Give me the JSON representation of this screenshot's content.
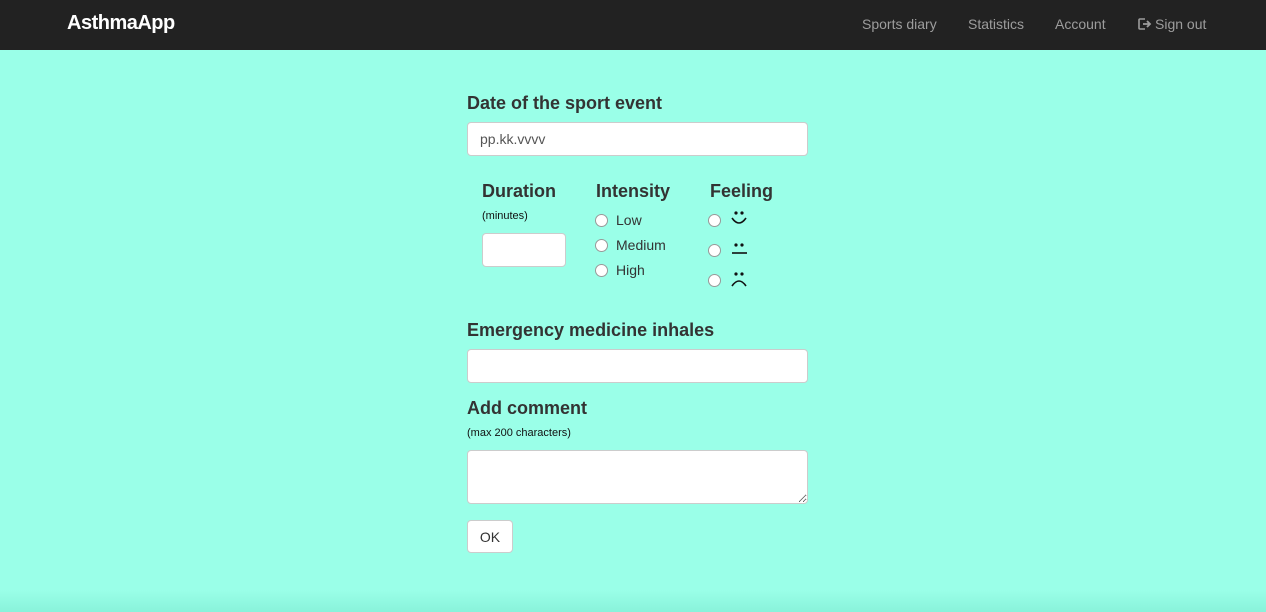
{
  "navbar": {
    "brand": "AsthmaApp",
    "links": {
      "sports_diary": "Sports diary",
      "statistics": "Statistics",
      "account": "Account",
      "sign_out": "Sign out"
    },
    "sign_out_icon": "sign-out-icon"
  },
  "form": {
    "date": {
      "label": "Date of the sport event",
      "placeholder": "pp.kk.vvvv",
      "value": ""
    },
    "duration": {
      "label": "Duration",
      "hint": "(minutes)",
      "value": ""
    },
    "intensity": {
      "label": "Intensity",
      "options": [
        "Low",
        "Medium",
        "High"
      ],
      "selected": null
    },
    "feeling": {
      "label": "Feeling",
      "options": [
        "happy-face-icon",
        "neutral-face-icon",
        "sad-face-icon"
      ],
      "selected": null
    },
    "inhales": {
      "label": "Emergency medicine inhales",
      "value": ""
    },
    "comment": {
      "label": "Add comment",
      "hint": "(max 200 characters)",
      "value": ""
    },
    "submit_label": "OK"
  },
  "colors": {
    "page_background": "#9affe8",
    "navbar_background": "#222222",
    "brand_text": "#ffffff",
    "nav_link_text": "#9d9d9d"
  }
}
